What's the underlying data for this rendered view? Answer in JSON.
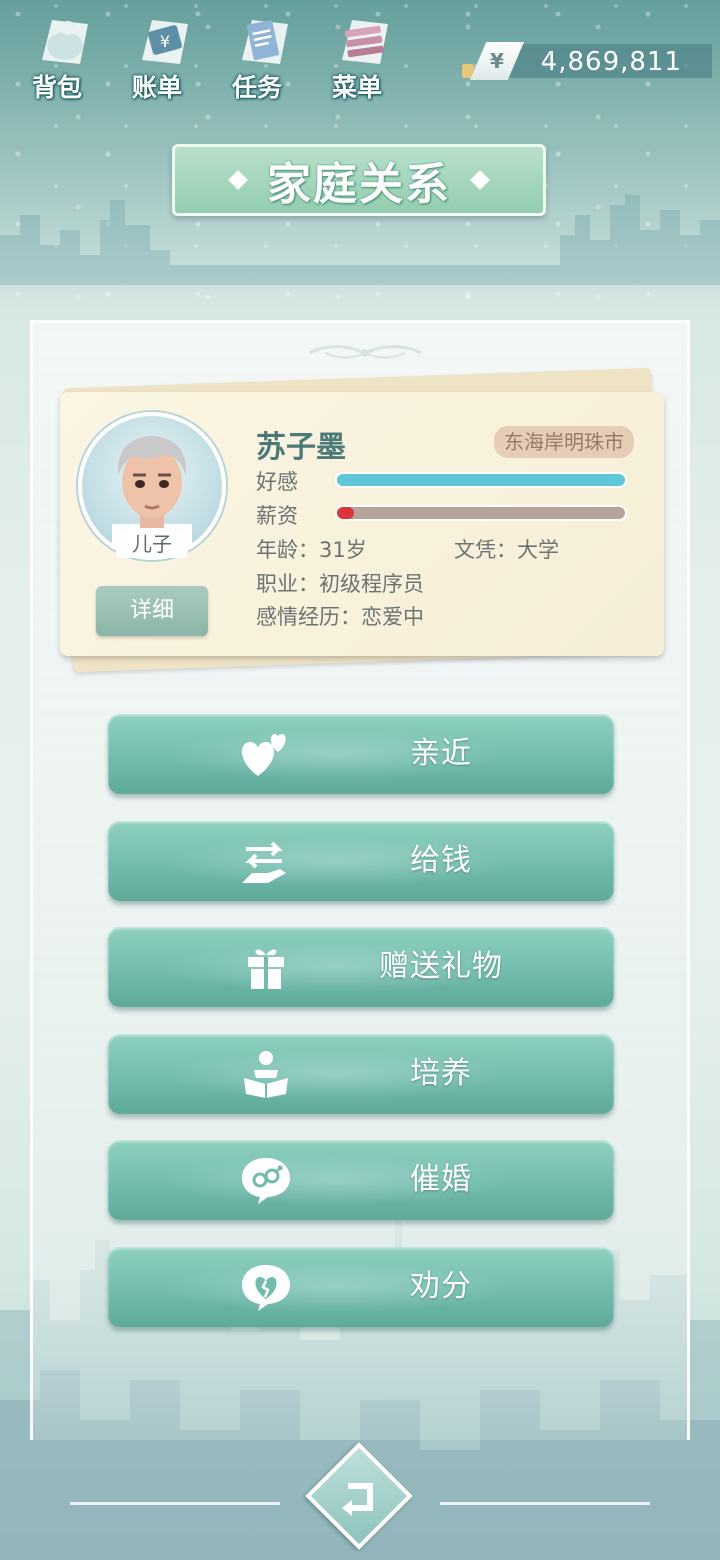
{
  "topbar": {
    "nav": [
      {
        "label": "背包",
        "icon": "bag-icon"
      },
      {
        "label": "账单",
        "icon": "bill-icon"
      },
      {
        "label": "任务",
        "icon": "task-icon"
      },
      {
        "label": "菜单",
        "icon": "menu-icon"
      }
    ],
    "currency_symbol": "¥",
    "money": "4,869,811"
  },
  "title": "家庭关系",
  "profile": {
    "relation": "儿子",
    "detail_label": "详细",
    "name": "苏子墨",
    "location": "东海岸明珠市",
    "favor_label": "好感",
    "favor_level": 1.0,
    "salary_label": "薪资",
    "salary_level": 0.06,
    "age": "年龄：31岁",
    "education": "文凭：大学",
    "job": "职业：初级程序员",
    "relationship": "感情经历：恋爱中"
  },
  "actions": [
    {
      "label": "亲近",
      "icon": "hearts-icon"
    },
    {
      "label": "给钱",
      "icon": "give-money-icon"
    },
    {
      "label": "赠送礼物",
      "icon": "gift-icon"
    },
    {
      "label": "培养",
      "icon": "reading-icon"
    },
    {
      "label": "催婚",
      "icon": "marriage-icon"
    },
    {
      "label": "劝分",
      "icon": "broken-heart-icon"
    }
  ],
  "colors": {
    "favor_bar": "#62c6d9",
    "salary_bar": "#d9363a",
    "track": "#b6a49a",
    "button": "#72bcad"
  }
}
